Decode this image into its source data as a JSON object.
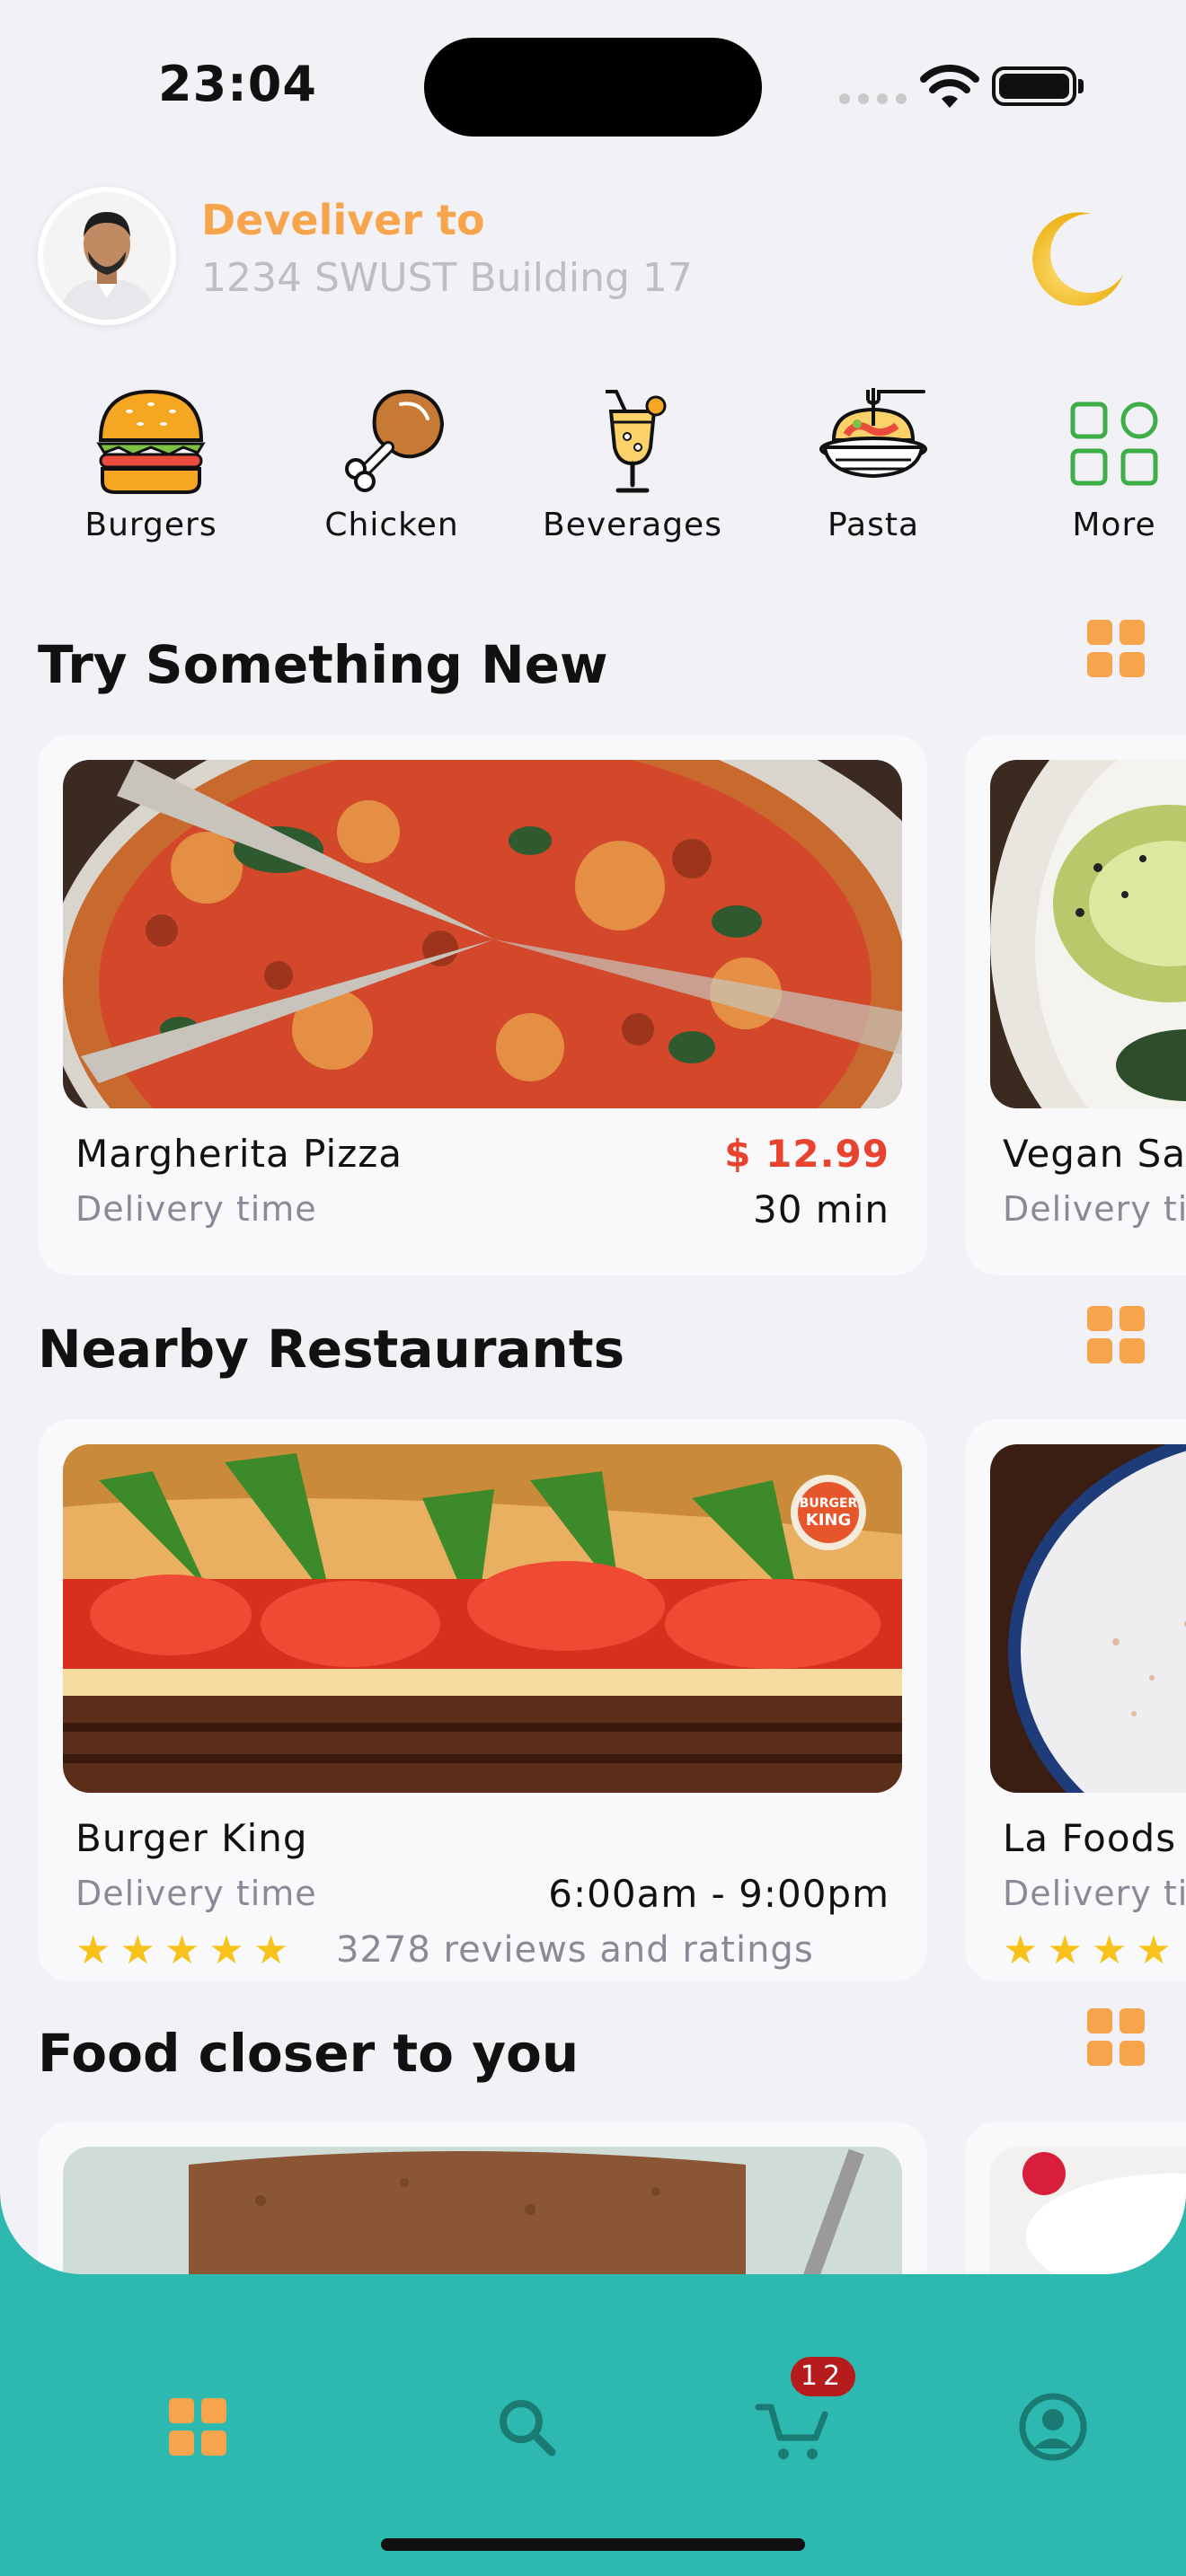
{
  "status_bar": {
    "time": "23:04"
  },
  "header": {
    "deliver_title": "Develiver to",
    "deliver_address": "1234 SWUST Building 17"
  },
  "categories": [
    {
      "label": "Burgers",
      "icon": "burger-icon"
    },
    {
      "label": "Chicken",
      "icon": "chicken-leg-icon"
    },
    {
      "label": "Beverages",
      "icon": "cocktail-icon"
    },
    {
      "label": "Pasta",
      "icon": "pasta-icon"
    },
    {
      "label": "More",
      "icon": "grid-more-icon"
    }
  ],
  "sections": {
    "try_new": {
      "title": "Try Something New",
      "cards": [
        {
          "name": "Margherita Pizza",
          "price": "$ 12.99",
          "sub_label": "Delivery time",
          "delivery_time": "30 min"
        },
        {
          "name": "Vegan Sa",
          "sub_label": "Delivery ti"
        }
      ]
    },
    "nearby": {
      "title": "Nearby Restaurants",
      "cards": [
        {
          "name": "Burger King",
          "sub_label": "Delivery time",
          "hours": "6:00am - 9:00pm",
          "rating": 5,
          "reviews": "3278 reviews and ratings"
        },
        {
          "name": "La Foods",
          "sub_label": "Delivery ti"
        }
      ]
    },
    "closer": {
      "title": "Food closer to you"
    }
  },
  "nav": {
    "items": [
      "home-icon",
      "search-icon",
      "cart-icon",
      "profile-icon"
    ],
    "cart_badge": "12",
    "active_color": "#f6a54c",
    "inactive_color": "#1a7a74"
  },
  "colors": {
    "accent": "#f6a54c",
    "price": "#e8432e",
    "nav_bg": "#2db8b0",
    "star": "#f8c21a"
  }
}
